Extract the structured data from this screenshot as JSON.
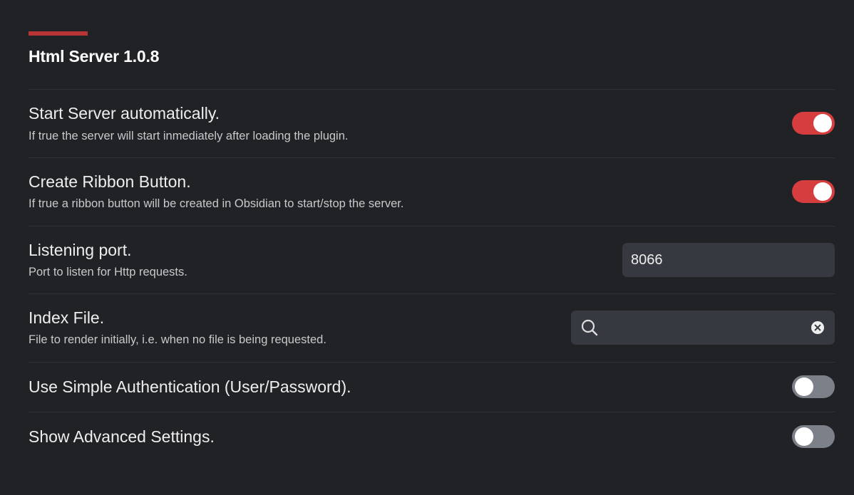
{
  "plugin": {
    "title": "Html Server 1.0.8",
    "accent_color": "#b73536"
  },
  "settings": {
    "start_server": {
      "name": "Start Server automatically.",
      "description": "If true the server will start inmediately after loading the plugin.",
      "enabled": true
    },
    "ribbon_button": {
      "name": "Create Ribbon Button.",
      "description": "If true a ribbon button will be created in Obsidian to start/stop the server.",
      "enabled": true
    },
    "listening_port": {
      "name": "Listening port.",
      "description": "Port to listen for Http requests.",
      "value": "8066"
    },
    "index_file": {
      "name": "Index File.",
      "description": "File to render initially, i.e. when no file is being requested.",
      "value": "",
      "icon": "search-icon",
      "clear_icon": "clear-icon"
    },
    "simple_auth": {
      "name": "Use Simple Authentication (User/Password).",
      "enabled": false
    },
    "advanced_settings": {
      "name": "Show Advanced Settings.",
      "enabled": false
    }
  },
  "colors": {
    "background": "#202226",
    "toggle_on": "#d63d3f",
    "toggle_off": "#7c8189",
    "input_background": "#363940"
  }
}
